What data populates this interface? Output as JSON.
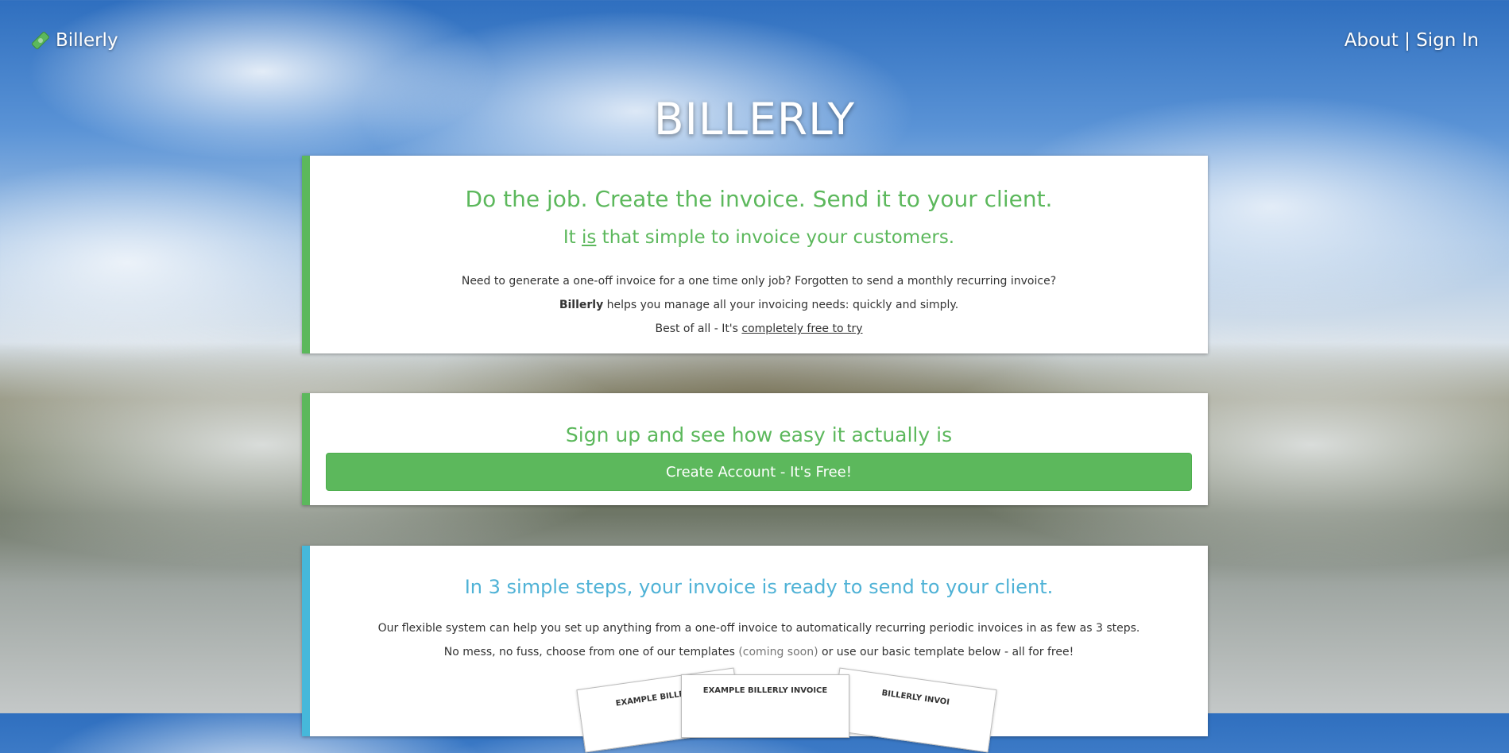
{
  "nav": {
    "brand": "Billerly",
    "about": "About",
    "separator": "|",
    "signin": "Sign In"
  },
  "hero": {
    "title": "BILLERLY"
  },
  "intro": {
    "headline": "Do the job. Create the invoice. Send it to your client.",
    "sub_prefix": "It ",
    "sub_emph": "is",
    "sub_suffix": " that simple to invoice your customers.",
    "line1": "Need to generate a one-off invoice for a one time only job? Forgotten to send a monthly recurring invoice?",
    "line2_bold": "Billerly",
    "line2_rest": " helps you manage all your invoicing needs: quickly and simply.",
    "line3_prefix": "Best of all - It's ",
    "line3_link": "completely free to try"
  },
  "signup": {
    "headline": "Sign up and see how easy it actually is",
    "button": "Create Account - It's Free!"
  },
  "steps": {
    "headline": "In 3 simple steps, your invoice is ready to send to your client.",
    "line1": "Our flexible system can help you set up anything from a one-off invoice to automatically recurring periodic invoices in as few as 3 steps.",
    "line2_prefix": "No mess, no fuss, choose from one of our templates ",
    "line2_muted": "(coming soon)",
    "line2_suffix": " or use our basic template below - all for free!",
    "invoice_left": "EXAMPLE BILLERLY",
    "invoice_center": "EXAMPLE BILLERLY INVOICE",
    "invoice_right": "BILLERLY INVOI"
  },
  "colors": {
    "green": "#5cb85c",
    "blue": "#4fb2d6"
  },
  "icons": {
    "brand": "money-bill-icon"
  }
}
